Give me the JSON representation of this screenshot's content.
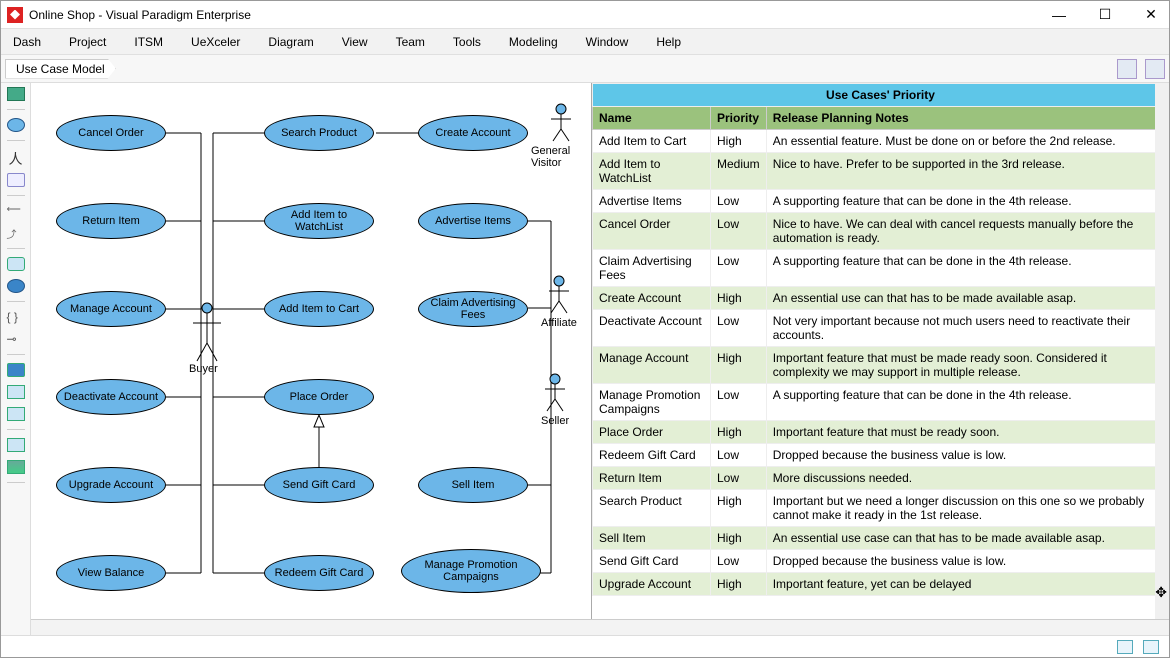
{
  "window_title": "Online Shop - Visual Paradigm Enterprise",
  "menu": [
    "Dash",
    "Project",
    "ITSM",
    "UeXceler",
    "Diagram",
    "View",
    "Team",
    "Tools",
    "Modeling",
    "Window",
    "Help"
  ],
  "breadcrumb": "Use Case Model",
  "actors": {
    "buyer": "Buyer",
    "general_visitor": "General Visitor",
    "affiliate": "Affiliate",
    "seller": "Seller"
  },
  "use_cases": {
    "cancel_order": "Cancel Order",
    "return_item": "Return Item",
    "manage_account": "Manage Account",
    "deactivate_account": "Deactivate Account",
    "upgrade_account": "Upgrade Account",
    "view_balance": "View Balance",
    "search_product": "Search Product",
    "add_watchlist": "Add Item to WatchList",
    "add_cart": "Add Item to Cart",
    "place_order": "Place Order",
    "send_gift": "Send Gift Card",
    "redeem_gift": "Redeem Gift Card",
    "create_account": "Create Account",
    "advertise": "Advertise Items",
    "claim_fees": "Claim Advertising Fees",
    "sell_item": "Sell Item",
    "manage_promo": "Manage Promotion Campaigns"
  },
  "table": {
    "title": "Use Cases' Priority",
    "headers": [
      "Name",
      "Priority",
      "Release Planning Notes"
    ],
    "rows": [
      [
        "Add Item to Cart",
        "High",
        "An essential feature. Must be done on or before the 2nd release."
      ],
      [
        "Add Item to WatchList",
        "Medium",
        "Nice to have. Prefer to be supported in the 3rd release."
      ],
      [
        "Advertise Items",
        "Low",
        "A supporting feature that can be done in the 4th release."
      ],
      [
        "Cancel Order",
        "Low",
        "Nice to have. We can deal with cancel requests manually before the automation is ready."
      ],
      [
        "Claim Advertising Fees",
        "Low",
        "A supporting feature that can be done in the 4th release."
      ],
      [
        "Create Account",
        "High",
        "An essential use can that has to be made available asap."
      ],
      [
        "Deactivate Account",
        "Low",
        "Not very important because not much users need to reactivate their accounts."
      ],
      [
        "Manage Account",
        "High",
        "Important feature that must be made ready soon. Considered it complexity we may support in multiple release."
      ],
      [
        "Manage Promotion Campaigns",
        "Low",
        "A supporting feature that can be done in the 4th release."
      ],
      [
        "Place Order",
        "High",
        "Important feature that must be ready soon."
      ],
      [
        "Redeem Gift Card",
        "Low",
        "Dropped because the business value is low."
      ],
      [
        "Return Item",
        "Low",
        "More discussions needed."
      ],
      [
        "Search Product",
        "High",
        "Important but we need a longer discussion on this one so we probably cannot make it ready in the 1st release."
      ],
      [
        "Sell Item",
        "High",
        "An essential use case can that has to be made available asap."
      ],
      [
        "Send Gift Card",
        "Low",
        "Dropped because the business value is low."
      ],
      [
        "Upgrade Account",
        "High",
        "Important feature, yet can be delayed"
      ]
    ]
  }
}
